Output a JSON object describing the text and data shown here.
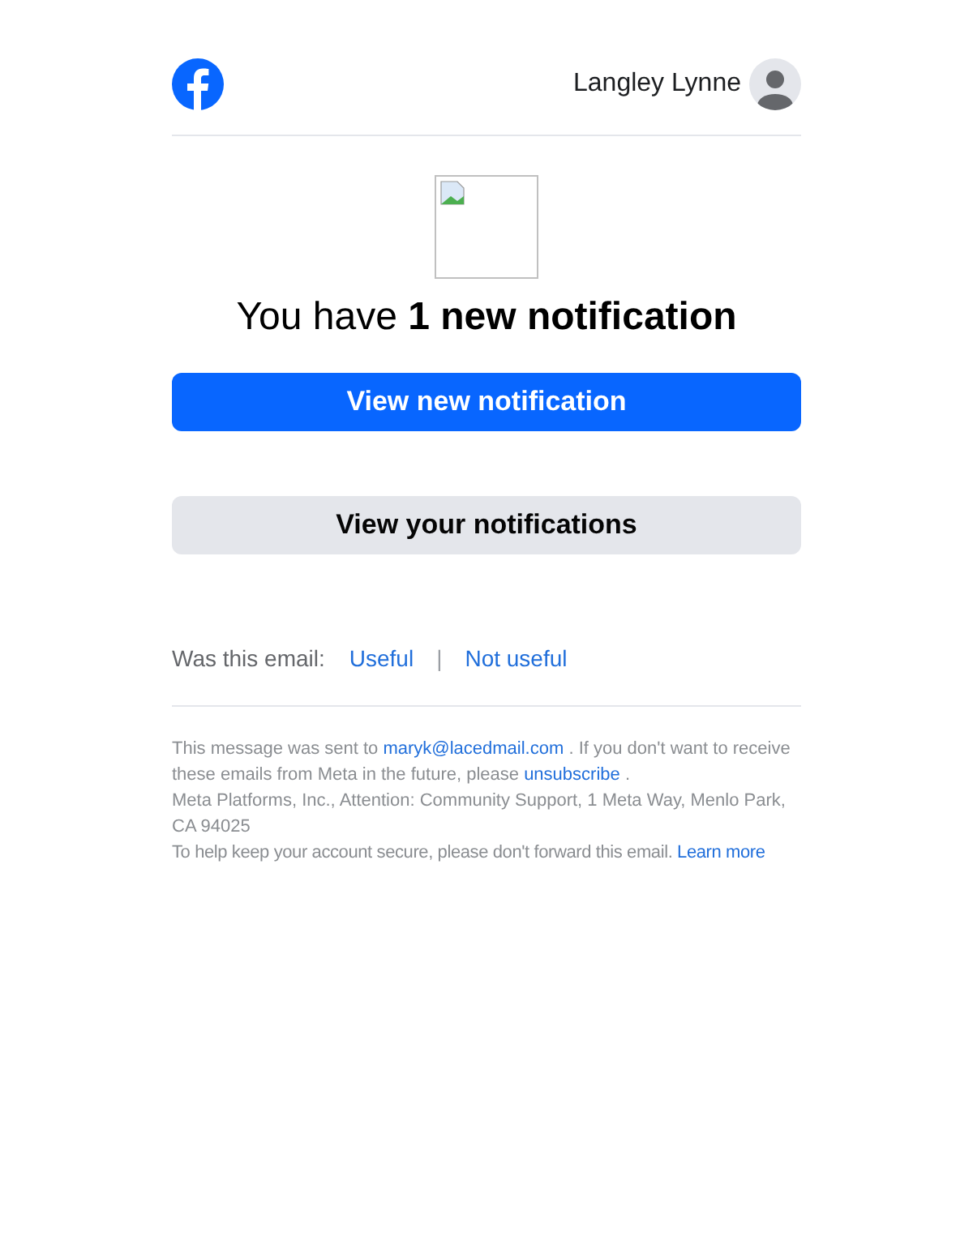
{
  "header": {
    "user_name": "Langley Lynne"
  },
  "headline": {
    "prefix": "You have ",
    "bold": "1 new notification"
  },
  "buttons": [
    {
      "label": "View new notification",
      "kind": "primary"
    },
    {
      "label": "View your notifications",
      "kind": "secondary"
    }
  ],
  "feedback": {
    "question": "Was this email:",
    "options": [
      "Useful",
      "Not useful"
    ],
    "separator": "|"
  },
  "footer": {
    "sent_prefix": "This message was sent to ",
    "email": "maryk@lacedmail.com",
    "sent_middle": " . If you don't want to receive these emails from Meta in the future, please ",
    "unsubscribe": "unsubscribe",
    "sent_end": " .",
    "address": "Meta Platforms, Inc., Attention: Community Support, 1 Meta Way, Menlo Park, CA 94025",
    "secure": "To help keep your account secure, please don't forward this email. ",
    "learn_more": "Learn more"
  }
}
